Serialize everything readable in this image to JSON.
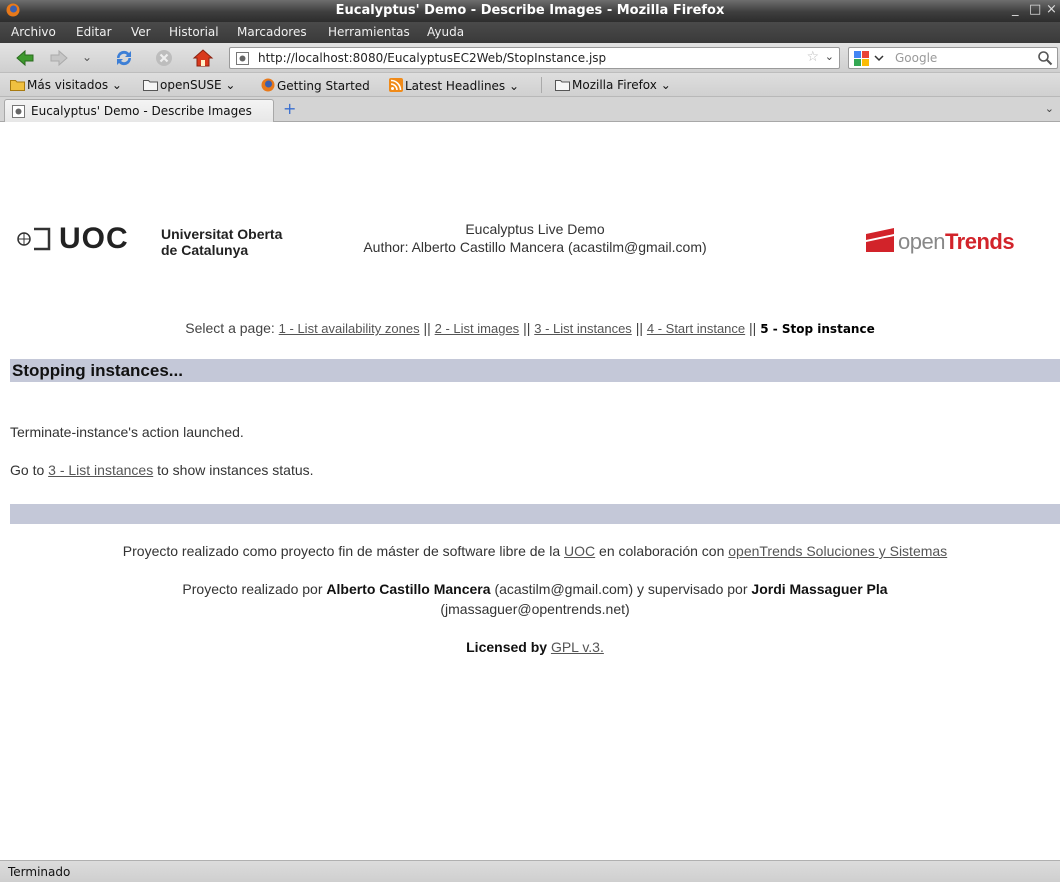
{
  "window": {
    "title": "Eucalyptus' Demo - Describe Images - Mozilla Firefox",
    "minimize": "_",
    "maximize": "□",
    "close": "×"
  },
  "menu": [
    {
      "label": "Archivo"
    },
    {
      "label": "Editar"
    },
    {
      "label": "Ver"
    },
    {
      "label": "Historial"
    },
    {
      "label": "Marcadores"
    },
    {
      "label": "Herramientas"
    },
    {
      "label": "Ayuda"
    }
  ],
  "nav": {
    "url": "http://localhost:8080/EucalyptusEC2Web/StopInstance.jsp",
    "search_placeholder": "Google"
  },
  "bookmarks": [
    {
      "label": "Más visitados",
      "icon": "folder-icon"
    },
    {
      "label": "openSUSE",
      "icon": "folder-icon"
    },
    {
      "label": "Getting Started",
      "icon": "firefox-icon"
    },
    {
      "label": "Latest Headlines",
      "icon": "rss-icon"
    },
    {
      "label": "Mozilla Firefox",
      "icon": "folder-icon"
    }
  ],
  "tab": {
    "label": "Eucalyptus' Demo - Describe Images",
    "new_tab": "+"
  },
  "header": {
    "uoc_short": "UOC",
    "uoc_name_line1": "Universitat Oberta",
    "uoc_name_line2": "de Catalunya",
    "demo_title": "Eucalyptus Live Demo",
    "author": "Author: Alberto Castillo Mancera (acastilm@gmail.com)",
    "ot_open": "open",
    "ot_trends": "Trends"
  },
  "pagenav": {
    "prefix": "Select a page:",
    "sep": "||",
    "links": [
      "1 - List availability zones",
      "2 - List images",
      "3 - List instances",
      "4 - Start instance"
    ],
    "current": "5 - Stop instance"
  },
  "main": {
    "heading": "Stopping instances...",
    "message": "Terminate-instance's action launched.",
    "goto_prefix": "Go to",
    "goto_link": "3 - List instances",
    "goto_suffix": "to show instances status."
  },
  "footer": {
    "line1_prefix": "Proyecto realizado como proyecto fin de máster de software libre de la",
    "line1_link1": "UOC",
    "line1_mid": "en colaboración con",
    "line1_link2": "openTrends Soluciones y Sistemas",
    "line2_prefix": "Proyecto realizado por",
    "line2_name1": "Alberto Castillo Mancera",
    "line2_mid": "(acastilm@gmail.com) y supervisado por",
    "line2_name2": "Jordi Massaguer Pla",
    "line2_email": "(jmassaguer@opentrends.net)",
    "license_prefix": "Licensed by",
    "license_link": "GPL v.3."
  },
  "status": {
    "text": "Terminado"
  },
  "colors": {
    "section_bar": "#c4c8d8",
    "ot_red": "#d2232a"
  }
}
